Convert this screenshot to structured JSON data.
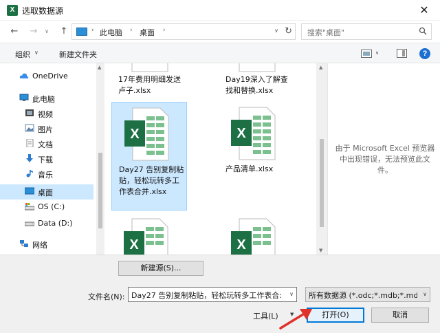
{
  "window": {
    "title": "选取数据源",
    "app_icon_letter": "X",
    "close_glyph": "✕"
  },
  "address": {
    "crumbs": [
      "此电脑",
      "桌面"
    ],
    "separator": "›",
    "search_placeholder": "搜索\"桌面\"",
    "refresh_glyph": "↻",
    "back_glyph": "←",
    "forward_glyph": "→",
    "up_glyph": "↑",
    "dropdown_glyph": "∨"
  },
  "toolbar": {
    "organize_label": "组织",
    "new_folder_label": "新建文件夹",
    "help_glyph": "?"
  },
  "sidebar": {
    "items": [
      {
        "label": "OneDrive",
        "icon": "cloud-icon",
        "color": "#3a8ee6"
      },
      {
        "label": "此电脑",
        "icon": "computer-icon",
        "color": "#2b8fd8"
      },
      {
        "label": "视频",
        "icon": "video-folder-icon",
        "color": "#555555"
      },
      {
        "label": "图片",
        "icon": "pictures-folder-icon",
        "color": "#5a7fa8"
      },
      {
        "label": "文档",
        "icon": "documents-folder-icon",
        "color": "#8a8a8a"
      },
      {
        "label": "下载",
        "icon": "download-icon",
        "color": "#2b7bd0"
      },
      {
        "label": "音乐",
        "icon": "music-icon",
        "color": "#2b7bd0"
      },
      {
        "label": "桌面",
        "icon": "desktop-icon",
        "color": "#2b8fd8",
        "selected": true
      },
      {
        "label": "OS (C:)",
        "icon": "drive-os-icon",
        "color": "#666666"
      },
      {
        "label": "Data (D:)",
        "icon": "drive-icon",
        "color": "#666666"
      },
      {
        "label": "网络",
        "icon": "network-icon",
        "color": "#2b7bd0"
      }
    ]
  },
  "files": [
    {
      "name": "17年费用明细发送卢子.xlsx",
      "selected": false
    },
    {
      "name": "Day19深入了解查找和替换.xlsx",
      "selected": false
    },
    {
      "name": "Day27 告别复制粘贴，轻松玩转多工作表合并.xlsx",
      "selected": true
    },
    {
      "name": "产品清单.xlsx",
      "selected": false
    },
    {
      "name": "",
      "selected": false
    },
    {
      "name": "",
      "selected": false
    }
  ],
  "preview": {
    "message": "由于 Microsoft Excel 预览器中出现错误，无法预览此文件。"
  },
  "bottom": {
    "new_source_label": "新建源(S)...",
    "filename_label": "文件名(N):",
    "filename_value": "Day27 告别复制粘贴，轻松玩转多工作表合:",
    "filetype_value": "所有数据源 (*.odc;*.mdb;*.mde",
    "tools_label": "工具(L)",
    "open_label": "打开(O)",
    "cancel_label": "取消"
  },
  "colors": {
    "excel_green": "#1d7044",
    "selection": "#cce8ff",
    "accent": "#0078d7",
    "annotation_arrow": "#e0302a"
  }
}
